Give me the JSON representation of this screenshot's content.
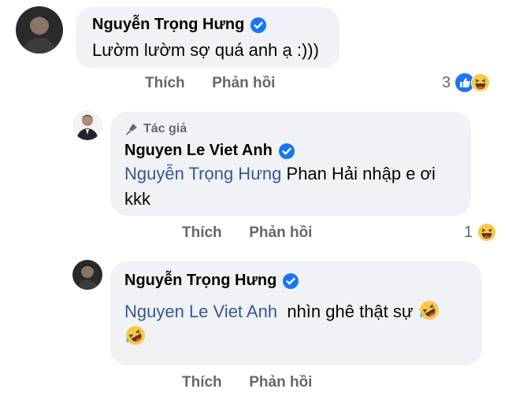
{
  "comments": [
    {
      "author": "Nguyễn Trọng Hưng",
      "text": "Lườm lườm sợ quá anh ạ :)))",
      "actions": {
        "like": "Thích",
        "reply": "Phản hồi"
      },
      "reactions": {
        "count": "3",
        "icons": [
          "like-icon",
          "haha-icon"
        ]
      }
    },
    {
      "author_badge": "Tác giả",
      "author": "Nguyen Le Viet Anh",
      "mention": "Nguyễn Trọng Hưng",
      "text_line1": " Phan Hải nhập e ơi",
      "text_line2": "kkk",
      "actions": {
        "like": "Thích",
        "reply": "Phản hồi"
      },
      "reactions": {
        "count": "1",
        "icons": [
          "haha-icon"
        ]
      }
    },
    {
      "author": "Nguyễn Trọng Hưng",
      "mention": "Nguyen Le Viet Anh",
      "text": "nhìn ghê thật sự",
      "emoji": [
        "rofl-emoji",
        "rofl-emoji"
      ],
      "actions": {
        "like": "Thích",
        "reply": "Phản hồi"
      }
    }
  ],
  "colors": {
    "bubble": "#f0f2f5",
    "verified": "#1877f2",
    "mention": "#365899",
    "muted": "#65676b"
  }
}
